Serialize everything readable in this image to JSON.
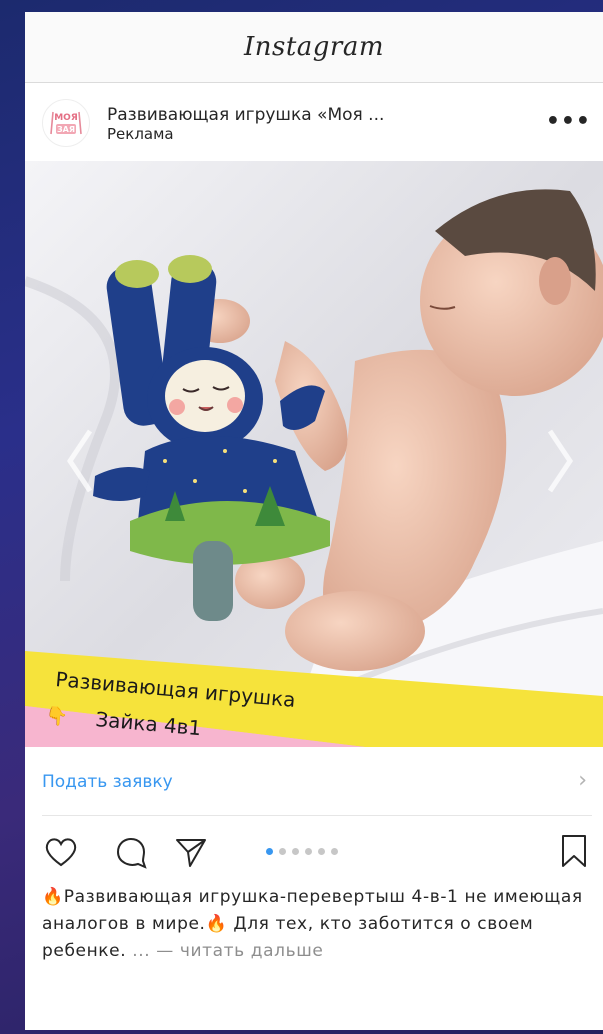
{
  "app": {
    "title": "Instagram"
  },
  "post": {
    "brand_name": "Развивающая игрушка «Моя ...",
    "sponsored_label": "Реклама",
    "avatar_text_top": "МОЯ",
    "avatar_text_bottom": "ЗАЯ",
    "more_label": "•••"
  },
  "photo": {
    "banner_line1": "Развивающая игрушка",
    "banner_line2": "Зайка 4в1",
    "pointing_emoji": "👇"
  },
  "cta": {
    "label": "Подать заявку",
    "chevron": "›"
  },
  "carousel": {
    "count": 6,
    "active_index": 0
  },
  "caption": {
    "fire1": "🔥",
    "part1": "Развивающая игрушка-перевертыш 4-в-1 не имеющая аналогов в мире.",
    "fire2": "🔥",
    "part2": " Для тех, кто заботится о своем ребенке. ",
    "more": "... — читать дальше"
  },
  "colors": {
    "link": "#3897f0",
    "banner_yellow": "#f6e33b",
    "banner_pink": "#f7b5cf"
  }
}
